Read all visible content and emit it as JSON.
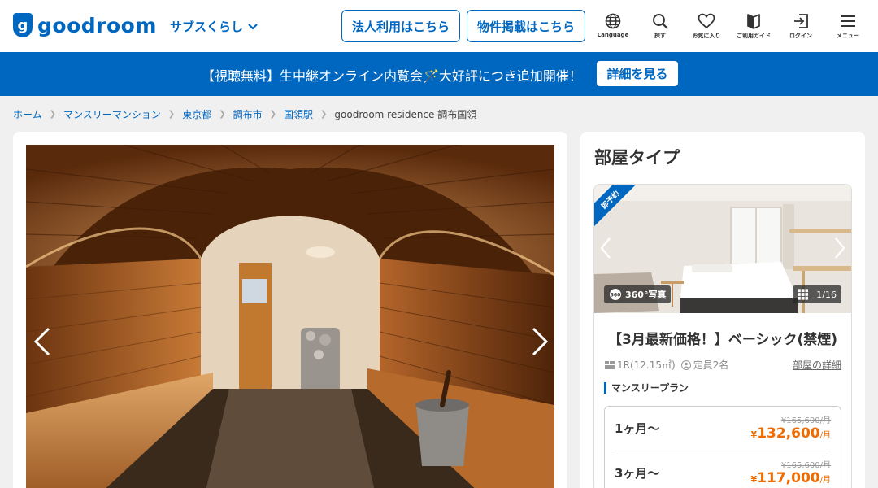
{
  "header": {
    "logo_text": "goodroom",
    "logo_mark": "g",
    "subs_label": "サブスくらし",
    "corporate_button": "法人利用はこちら",
    "listing_button": "物件掲載はこちら",
    "nav": [
      {
        "icon": "globe-icon",
        "label": "Language"
      },
      {
        "icon": "search-icon",
        "label": "探す"
      },
      {
        "icon": "heart-icon",
        "label": "お気に入り"
      },
      {
        "icon": "guide-icon",
        "label": "ご利用ガイド"
      },
      {
        "icon": "login-icon",
        "label": "ログイン"
      },
      {
        "icon": "menu-icon",
        "label": "メニュー"
      }
    ]
  },
  "banner": {
    "text": "【視聴無料】生中継オンライン内覧会🪄大好評につき追加開催！",
    "button": "詳細を見る"
  },
  "breadcrumb": [
    "ホーム",
    "マンスリーマンション",
    "東京都",
    "調布市",
    "国領駅",
    "goodroom residence 調布国領"
  ],
  "colors": {
    "brand": "#0067c0",
    "price": "#ef6b00"
  },
  "room_types": {
    "title": "部屋タイプ",
    "ribbon": "即予約",
    "photo_360": "360°写真",
    "photo_count": "1/16",
    "room_title": "【3月最新価格！】ベーシック(禁煙)",
    "size": "1R(12.15㎡)",
    "capacity": "定員2名",
    "detail_link": "部屋の詳細",
    "plan_label": "マンスリープラン",
    "plans": [
      {
        "term": "1ヶ月〜",
        "old_price": "¥165,600/月",
        "yen": "¥",
        "price": "132,600",
        "unit": "/月"
      },
      {
        "term": "3ヶ月〜",
        "old_price": "¥165,600/月",
        "yen": "¥",
        "price": "117,000",
        "unit": "/月"
      }
    ]
  }
}
